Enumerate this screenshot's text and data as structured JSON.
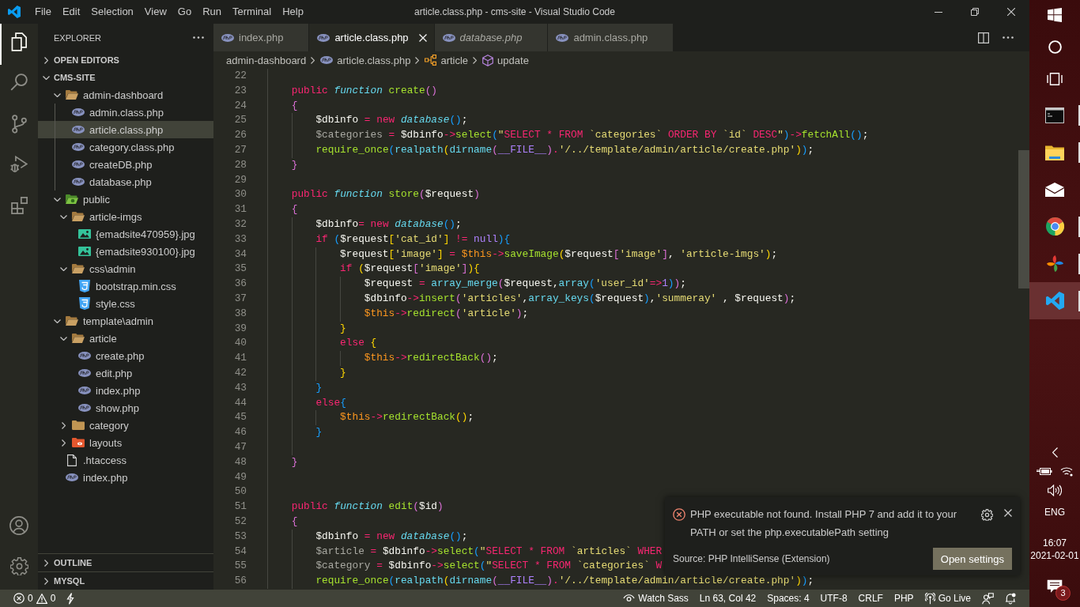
{
  "title_bar": {
    "menu": [
      "File",
      "Edit",
      "Selection",
      "View",
      "Go",
      "Run",
      "Terminal",
      "Help"
    ],
    "title": "article.class.php - cms-site - Visual Studio Code"
  },
  "activity_bar": {
    "items": [
      {
        "kind": "explorer",
        "selected": true
      },
      {
        "kind": "search",
        "selected": false
      },
      {
        "kind": "source-control",
        "selected": false
      },
      {
        "kind": "run-debug",
        "selected": false
      },
      {
        "kind": "extensions",
        "selected": false
      }
    ]
  },
  "sidebar": {
    "title": "EXPLORER",
    "sections": [
      {
        "label": "OPEN EDITORS",
        "expanded": false
      },
      {
        "label": "CMS-SITE",
        "expanded": true,
        "tree": [
          {
            "label": "admin-dashboard",
            "kind": "folder",
            "expanded": true,
            "selected": false,
            "children": [
              {
                "label": "admin.class.php",
                "kind": "php",
                "selected": false
              },
              {
                "label": "article.class.php",
                "kind": "php",
                "selected": true
              },
              {
                "label": "category.class.php",
                "kind": "php",
                "selected": false
              },
              {
                "label": "createDB.php",
                "kind": "php",
                "selected": false
              },
              {
                "label": "database.php",
                "kind": "php",
                "selected": false
              }
            ]
          },
          {
            "label": "public",
            "kind": "public-folder",
            "expanded": true,
            "selected": false,
            "children": [
              {
                "label": "article-imgs",
                "kind": "folder",
                "expanded": true,
                "selected": false,
                "children": [
                  {
                    "label": "{emadsite470959}.jpg",
                    "kind": "image",
                    "selected": false
                  },
                  {
                    "label": "{emadsite930100}.jpg",
                    "kind": "image",
                    "selected": false
                  }
                ]
              },
              {
                "label": "css\\admin",
                "kind": "folder",
                "expanded": true,
                "selected": false,
                "children": [
                  {
                    "label": "bootstrap.min.css",
                    "kind": "css",
                    "selected": false
                  },
                  {
                    "label": "style.css",
                    "kind": "css",
                    "selected": false
                  }
                ]
              }
            ]
          },
          {
            "label": "template\\admin",
            "kind": "folder",
            "expanded": true,
            "selected": false,
            "children": [
              {
                "label": "article",
                "kind": "folder",
                "expanded": true,
                "selected": false,
                "children": [
                  {
                    "label": "create.php",
                    "kind": "php",
                    "selected": false
                  },
                  {
                    "label": "edit.php",
                    "kind": "php",
                    "selected": false
                  },
                  {
                    "label": "index.php",
                    "kind": "php",
                    "selected": false
                  },
                  {
                    "label": "show.php",
                    "kind": "php",
                    "selected": false
                  }
                ]
              },
              {
                "label": "category",
                "kind": "folder",
                "expanded": false,
                "selected": false
              },
              {
                "label": "layouts",
                "kind": "layout-folder",
                "expanded": false,
                "selected": false
              }
            ]
          },
          {
            "label": ".htaccess",
            "kind": "file",
            "selected": false
          },
          {
            "label": "index.php",
            "kind": "php",
            "selected": false
          }
        ]
      },
      {
        "label": "OUTLINE",
        "expanded": false
      },
      {
        "label": "MYSQL",
        "expanded": false
      }
    ]
  },
  "editor": {
    "tabs": [
      {
        "label": "index.php",
        "selected": false,
        "preview": false
      },
      {
        "label": "article.class.php",
        "selected": true,
        "preview": false
      },
      {
        "label": "database.php",
        "selected": false,
        "preview": true
      },
      {
        "label": "admin.class.php",
        "selected": false,
        "preview": false
      }
    ],
    "breadcrumbs": [
      {
        "label": "admin-dashboard",
        "kind": "folder"
      },
      {
        "label": "article.class.php",
        "kind": "php"
      },
      {
        "label": "article",
        "kind": "class"
      },
      {
        "label": "update",
        "kind": "method"
      }
    ],
    "lines": [
      {
        "number": "22"
      },
      {
        "number": "23",
        "tokens": [
          {
            "kind": "keyword",
            "text": "    public "
          },
          {
            "kind": "storage",
            "text": "function "
          },
          {
            "kind": "func",
            "text": "create"
          },
          {
            "kind": "bracket2",
            "text": "()"
          }
        ]
      },
      {
        "number": "24",
        "tokens": [
          {
            "kind": "bracket2",
            "text": "    {"
          }
        ]
      },
      {
        "number": "25",
        "tokens": [
          {
            "kind": "var",
            "text": "        $dbinfo"
          },
          {
            "kind": "keyword",
            "text": " = new "
          },
          {
            "kind": "storage",
            "text": "database"
          },
          {
            "kind": "bracket3",
            "text": "()"
          },
          {
            "kind": "plain",
            "text": ";"
          }
        ]
      },
      {
        "number": "26",
        "tokens": [
          {
            "kind": "unused",
            "text": "        $categories"
          },
          {
            "kind": "keyword",
            "text": " = "
          },
          {
            "kind": "var",
            "text": "$dbinfo"
          },
          {
            "kind": "keyword",
            "text": "->"
          },
          {
            "kind": "func",
            "text": "select"
          },
          {
            "kind": "bracket3",
            "text": "("
          },
          {
            "kind": "string",
            "text": "\""
          },
          {
            "kind": "keyword",
            "text": "SELECT * FROM "
          },
          {
            "kind": "string",
            "text": "`categories` "
          },
          {
            "kind": "keyword",
            "text": "ORDER BY "
          },
          {
            "kind": "string",
            "text": "`id` "
          },
          {
            "kind": "keyword",
            "text": "DESC"
          },
          {
            "kind": "string",
            "text": "\""
          },
          {
            "kind": "bracket3",
            "text": ")"
          },
          {
            "kind": "keyword",
            "text": "->"
          },
          {
            "kind": "func",
            "text": "fetchAll"
          },
          {
            "kind": "bracket3",
            "text": "()"
          },
          {
            "kind": "plain",
            "text": ";"
          }
        ]
      },
      {
        "number": "27",
        "tokens": [
          {
            "kind": "func",
            "text": "        require_once"
          },
          {
            "kind": "bracket3",
            "text": "("
          },
          {
            "kind": "builtin",
            "text": "realpath"
          },
          {
            "kind": "bracket1",
            "text": "("
          },
          {
            "kind": "builtin",
            "text": "dirname"
          },
          {
            "kind": "bracket2",
            "text": "("
          },
          {
            "kind": "const",
            "text": "__FILE__"
          },
          {
            "kind": "bracket2",
            "text": ")"
          },
          {
            "kind": "keyword",
            "text": "."
          },
          {
            "kind": "string",
            "text": "'/../template/admin/article/create.php'"
          },
          {
            "kind": "bracket1",
            "text": ")"
          },
          {
            "kind": "bracket3",
            "text": ")"
          },
          {
            "kind": "plain",
            "text": ";"
          }
        ]
      },
      {
        "number": "28",
        "tokens": [
          {
            "kind": "bracket2",
            "text": "    }"
          }
        ]
      },
      {
        "number": "29"
      },
      {
        "number": "30",
        "tokens": [
          {
            "kind": "keyword",
            "text": "    public "
          },
          {
            "kind": "storage",
            "text": "function "
          },
          {
            "kind": "func",
            "text": "store"
          },
          {
            "kind": "bracket2",
            "text": "("
          },
          {
            "kind": "var",
            "text": "$request"
          },
          {
            "kind": "bracket2",
            "text": ")"
          }
        ]
      },
      {
        "number": "31",
        "tokens": [
          {
            "kind": "bracket2",
            "text": "    {"
          }
        ]
      },
      {
        "number": "32",
        "tokens": [
          {
            "kind": "var",
            "text": "        $dbinfo"
          },
          {
            "kind": "keyword",
            "text": "= new "
          },
          {
            "kind": "storage",
            "text": "database"
          },
          {
            "kind": "bracket3",
            "text": "()"
          },
          {
            "kind": "plain",
            "text": ";"
          }
        ]
      },
      {
        "number": "33",
        "tokens": [
          {
            "kind": "keyword",
            "text": "        if "
          },
          {
            "kind": "bracket3",
            "text": "("
          },
          {
            "kind": "var",
            "text": "$request"
          },
          {
            "kind": "bracket1",
            "text": "["
          },
          {
            "kind": "string",
            "text": "'cat_id'"
          },
          {
            "kind": "bracket1",
            "text": "]"
          },
          {
            "kind": "keyword",
            "text": " != "
          },
          {
            "kind": "const",
            "text": "null"
          },
          {
            "kind": "bracket3",
            "text": "){"
          }
        ]
      },
      {
        "number": "34",
        "tokens": [
          {
            "kind": "var",
            "text": "            $request"
          },
          {
            "kind": "bracket1",
            "text": "["
          },
          {
            "kind": "string",
            "text": "'image'"
          },
          {
            "kind": "bracket1",
            "text": "]"
          },
          {
            "kind": "keyword",
            "text": " = "
          },
          {
            "kind": "self",
            "text": "$this"
          },
          {
            "kind": "keyword",
            "text": "->"
          },
          {
            "kind": "func",
            "text": "saveImage"
          },
          {
            "kind": "bracket1",
            "text": "("
          },
          {
            "kind": "var",
            "text": "$request"
          },
          {
            "kind": "bracket2",
            "text": "["
          },
          {
            "kind": "string",
            "text": "'image'"
          },
          {
            "kind": "bracket2",
            "text": "]"
          },
          {
            "kind": "plain",
            "text": ", "
          },
          {
            "kind": "string",
            "text": "'article-imgs'"
          },
          {
            "kind": "bracket1",
            "text": ")"
          },
          {
            "kind": "plain",
            "text": ";"
          }
        ]
      },
      {
        "number": "35",
        "tokens": [
          {
            "kind": "keyword",
            "text": "            if "
          },
          {
            "kind": "bracket1",
            "text": "("
          },
          {
            "kind": "var",
            "text": "$request"
          },
          {
            "kind": "bracket2",
            "text": "["
          },
          {
            "kind": "string",
            "text": "'image'"
          },
          {
            "kind": "bracket2",
            "text": "]"
          },
          {
            "kind": "bracket1",
            "text": "){"
          }
        ]
      },
      {
        "number": "36",
        "tokens": [
          {
            "kind": "var",
            "text": "                $request"
          },
          {
            "kind": "keyword",
            "text": " = "
          },
          {
            "kind": "builtin",
            "text": "array_merge"
          },
          {
            "kind": "bracket2",
            "text": "("
          },
          {
            "kind": "var",
            "text": "$request"
          },
          {
            "kind": "plain",
            "text": ","
          },
          {
            "kind": "builtin",
            "text": "array"
          },
          {
            "kind": "bracket3",
            "text": "("
          },
          {
            "kind": "string",
            "text": "'user_id'"
          },
          {
            "kind": "keyword",
            "text": "=>"
          },
          {
            "kind": "const",
            "text": "1"
          },
          {
            "kind": "bracket3",
            "text": ")"
          },
          {
            "kind": "bracket2",
            "text": ")"
          },
          {
            "kind": "plain",
            "text": ";"
          }
        ]
      },
      {
        "number": "37",
        "tokens": [
          {
            "kind": "var",
            "text": "                $dbinfo"
          },
          {
            "kind": "keyword",
            "text": "->"
          },
          {
            "kind": "func",
            "text": "insert"
          },
          {
            "kind": "bracket2",
            "text": "("
          },
          {
            "kind": "string",
            "text": "'articles'"
          },
          {
            "kind": "plain",
            "text": ","
          },
          {
            "kind": "builtin",
            "text": "array_keys"
          },
          {
            "kind": "bracket3",
            "text": "("
          },
          {
            "kind": "var",
            "text": "$request"
          },
          {
            "kind": "bracket3",
            "text": ")"
          },
          {
            "kind": "plain",
            "text": ","
          },
          {
            "kind": "string",
            "text": "'summeray'"
          },
          {
            "kind": "plain",
            "text": " , "
          },
          {
            "kind": "var",
            "text": "$request"
          },
          {
            "kind": "bracket2",
            "text": ")"
          },
          {
            "kind": "plain",
            "text": ";"
          }
        ]
      },
      {
        "number": "38",
        "tokens": [
          {
            "kind": "self",
            "text": "                $this"
          },
          {
            "kind": "keyword",
            "text": "->"
          },
          {
            "kind": "func",
            "text": "redirect"
          },
          {
            "kind": "bracket2",
            "text": "("
          },
          {
            "kind": "string",
            "text": "'article'"
          },
          {
            "kind": "bracket2",
            "text": ")"
          },
          {
            "kind": "plain",
            "text": ";"
          }
        ]
      },
      {
        "number": "39",
        "tokens": [
          {
            "kind": "bracket1",
            "text": "            }"
          }
        ]
      },
      {
        "number": "40",
        "tokens": [
          {
            "kind": "keyword",
            "text": "            else "
          },
          {
            "kind": "bracket1",
            "text": "{"
          }
        ]
      },
      {
        "number": "41",
        "tokens": [
          {
            "kind": "self",
            "text": "                $this"
          },
          {
            "kind": "keyword",
            "text": "->"
          },
          {
            "kind": "func",
            "text": "redirectBack"
          },
          {
            "kind": "bracket2",
            "text": "()"
          },
          {
            "kind": "plain",
            "text": ";"
          }
        ]
      },
      {
        "number": "42",
        "tokens": [
          {
            "kind": "bracket1",
            "text": "            }"
          }
        ]
      },
      {
        "number": "43",
        "tokens": [
          {
            "kind": "bracket3",
            "text": "        }"
          }
        ]
      },
      {
        "number": "44",
        "tokens": [
          {
            "kind": "keyword",
            "text": "        else"
          },
          {
            "kind": "bracket3",
            "text": "{"
          }
        ]
      },
      {
        "number": "45",
        "tokens": [
          {
            "kind": "self",
            "text": "            $this"
          },
          {
            "kind": "keyword",
            "text": "->"
          },
          {
            "kind": "func",
            "text": "redirectBack"
          },
          {
            "kind": "bracket1",
            "text": "()"
          },
          {
            "kind": "plain",
            "text": ";"
          }
        ]
      },
      {
        "number": "46",
        "tokens": [
          {
            "kind": "bracket3",
            "text": "        }"
          }
        ]
      },
      {
        "number": "47"
      },
      {
        "number": "48",
        "tokens": [
          {
            "kind": "bracket2",
            "text": "    }"
          }
        ]
      },
      {
        "number": "49"
      },
      {
        "number": "50"
      },
      {
        "number": "51",
        "tokens": [
          {
            "kind": "keyword",
            "text": "    public "
          },
          {
            "kind": "storage",
            "text": "function "
          },
          {
            "kind": "func",
            "text": "edit"
          },
          {
            "kind": "bracket2",
            "text": "("
          },
          {
            "kind": "var",
            "text": "$id"
          },
          {
            "kind": "bracket2",
            "text": ")"
          }
        ]
      },
      {
        "number": "52",
        "tokens": [
          {
            "kind": "bracket2",
            "text": "    {"
          }
        ]
      },
      {
        "number": "53",
        "tokens": [
          {
            "kind": "var",
            "text": "        $dbinfo"
          },
          {
            "kind": "keyword",
            "text": " = new "
          },
          {
            "kind": "storage",
            "text": "database"
          },
          {
            "kind": "bracket3",
            "text": "()"
          },
          {
            "kind": "plain",
            "text": ";"
          }
        ]
      },
      {
        "number": "54",
        "tokens": [
          {
            "kind": "unused",
            "text": "        $article"
          },
          {
            "kind": "keyword",
            "text": " = "
          },
          {
            "kind": "var",
            "text": "$dbinfo"
          },
          {
            "kind": "keyword",
            "text": "->"
          },
          {
            "kind": "func",
            "text": "select"
          },
          {
            "kind": "bracket3",
            "text": "("
          },
          {
            "kind": "string",
            "text": "\""
          },
          {
            "kind": "keyword",
            "text": "SELECT * FROM "
          },
          {
            "kind": "string",
            "text": "`articles` "
          },
          {
            "kind": "keyword",
            "text": "WHER"
          }
        ]
      },
      {
        "number": "55",
        "tokens": [
          {
            "kind": "unused",
            "text": "        $category"
          },
          {
            "kind": "keyword",
            "text": " = "
          },
          {
            "kind": "var",
            "text": "$dbinfo"
          },
          {
            "kind": "keyword",
            "text": "->"
          },
          {
            "kind": "func",
            "text": "select"
          },
          {
            "kind": "bracket3",
            "text": "("
          },
          {
            "kind": "string",
            "text": "\""
          },
          {
            "kind": "keyword",
            "text": "SELECT * FROM "
          },
          {
            "kind": "string",
            "text": "`categories` "
          },
          {
            "kind": "keyword",
            "text": "W"
          }
        ]
      },
      {
        "number": "56",
        "tokens": [
          {
            "kind": "func",
            "text": "        require_once"
          },
          {
            "kind": "bracket3",
            "text": "("
          },
          {
            "kind": "builtin",
            "text": "realpath"
          },
          {
            "kind": "bracket1",
            "text": "("
          },
          {
            "kind": "builtin",
            "text": "dirname"
          },
          {
            "kind": "bracket2",
            "text": "("
          },
          {
            "kind": "const",
            "text": "__FILE__"
          },
          {
            "kind": "bracket2",
            "text": ")"
          },
          {
            "kind": "keyword",
            "text": "."
          },
          {
            "kind": "string",
            "text": "'/../template/admin/article/create.php'"
          },
          {
            "kind": "bracket1",
            "text": ")"
          },
          {
            "kind": "bracket3",
            "text": ")"
          },
          {
            "kind": "plain",
            "text": ";"
          }
        ]
      }
    ]
  },
  "notification": {
    "kind": "error",
    "message": "PHP executable not found. Install PHP 7 and add it to your PATH or set the php.executablePath setting",
    "source": "Source: PHP IntelliSense (Extension)",
    "action": "Open settings"
  },
  "status_bar": {
    "errors": "0",
    "warnings": "0",
    "items": [
      {
        "kind": "watch",
        "label": "Watch Sass"
      },
      {
        "kind": "text",
        "label": "Ln 63, Col 42"
      },
      {
        "kind": "text",
        "label": "Spaces: 4"
      },
      {
        "kind": "text",
        "label": "UTF-8"
      },
      {
        "kind": "text",
        "label": "CRLF"
      },
      {
        "kind": "text",
        "label": "PHP"
      },
      {
        "kind": "live",
        "label": "Go Live"
      }
    ]
  },
  "taskbar": {
    "apps": [
      {
        "kind": "terminal",
        "running": true,
        "selected": false
      },
      {
        "kind": "file-explorer",
        "running": true,
        "selected": false
      },
      {
        "kind": "mail",
        "running": false,
        "selected": false
      },
      {
        "kind": "browser",
        "running": true,
        "selected": false
      },
      {
        "kind": "pinwheel",
        "running": true,
        "selected": false
      },
      {
        "kind": "code-editor",
        "running": true,
        "selected": true
      }
    ],
    "tray": {
      "language": "ENG",
      "time": "16:07",
      "date": "2021-02-01",
      "notifications": "3"
    }
  }
}
